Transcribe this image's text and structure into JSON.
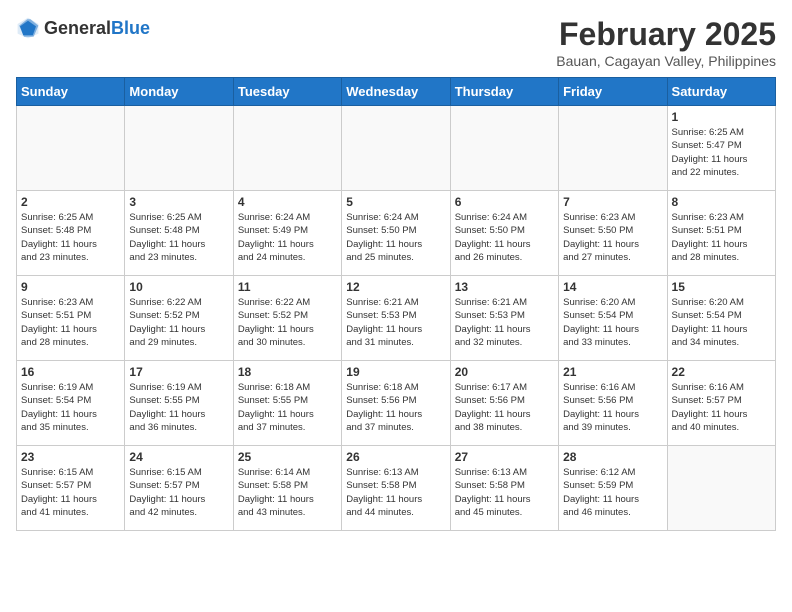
{
  "header": {
    "logo_general": "General",
    "logo_blue": "Blue",
    "month_title": "February 2025",
    "location": "Bauan, Cagayan Valley, Philippines"
  },
  "weekdays": [
    "Sunday",
    "Monday",
    "Tuesday",
    "Wednesday",
    "Thursday",
    "Friday",
    "Saturday"
  ],
  "weeks": [
    [
      {
        "day": "",
        "info": ""
      },
      {
        "day": "",
        "info": ""
      },
      {
        "day": "",
        "info": ""
      },
      {
        "day": "",
        "info": ""
      },
      {
        "day": "",
        "info": ""
      },
      {
        "day": "",
        "info": ""
      },
      {
        "day": "1",
        "info": "Sunrise: 6:25 AM\nSunset: 5:47 PM\nDaylight: 11 hours\nand 22 minutes."
      }
    ],
    [
      {
        "day": "2",
        "info": "Sunrise: 6:25 AM\nSunset: 5:48 PM\nDaylight: 11 hours\nand 23 minutes."
      },
      {
        "day": "3",
        "info": "Sunrise: 6:25 AM\nSunset: 5:48 PM\nDaylight: 11 hours\nand 23 minutes."
      },
      {
        "day": "4",
        "info": "Sunrise: 6:24 AM\nSunset: 5:49 PM\nDaylight: 11 hours\nand 24 minutes."
      },
      {
        "day": "5",
        "info": "Sunrise: 6:24 AM\nSunset: 5:50 PM\nDaylight: 11 hours\nand 25 minutes."
      },
      {
        "day": "6",
        "info": "Sunrise: 6:24 AM\nSunset: 5:50 PM\nDaylight: 11 hours\nand 26 minutes."
      },
      {
        "day": "7",
        "info": "Sunrise: 6:23 AM\nSunset: 5:50 PM\nDaylight: 11 hours\nand 27 minutes."
      },
      {
        "day": "8",
        "info": "Sunrise: 6:23 AM\nSunset: 5:51 PM\nDaylight: 11 hours\nand 28 minutes."
      }
    ],
    [
      {
        "day": "9",
        "info": "Sunrise: 6:23 AM\nSunset: 5:51 PM\nDaylight: 11 hours\nand 28 minutes."
      },
      {
        "day": "10",
        "info": "Sunrise: 6:22 AM\nSunset: 5:52 PM\nDaylight: 11 hours\nand 29 minutes."
      },
      {
        "day": "11",
        "info": "Sunrise: 6:22 AM\nSunset: 5:52 PM\nDaylight: 11 hours\nand 30 minutes."
      },
      {
        "day": "12",
        "info": "Sunrise: 6:21 AM\nSunset: 5:53 PM\nDaylight: 11 hours\nand 31 minutes."
      },
      {
        "day": "13",
        "info": "Sunrise: 6:21 AM\nSunset: 5:53 PM\nDaylight: 11 hours\nand 32 minutes."
      },
      {
        "day": "14",
        "info": "Sunrise: 6:20 AM\nSunset: 5:54 PM\nDaylight: 11 hours\nand 33 minutes."
      },
      {
        "day": "15",
        "info": "Sunrise: 6:20 AM\nSunset: 5:54 PM\nDaylight: 11 hours\nand 34 minutes."
      }
    ],
    [
      {
        "day": "16",
        "info": "Sunrise: 6:19 AM\nSunset: 5:54 PM\nDaylight: 11 hours\nand 35 minutes."
      },
      {
        "day": "17",
        "info": "Sunrise: 6:19 AM\nSunset: 5:55 PM\nDaylight: 11 hours\nand 36 minutes."
      },
      {
        "day": "18",
        "info": "Sunrise: 6:18 AM\nSunset: 5:55 PM\nDaylight: 11 hours\nand 37 minutes."
      },
      {
        "day": "19",
        "info": "Sunrise: 6:18 AM\nSunset: 5:56 PM\nDaylight: 11 hours\nand 37 minutes."
      },
      {
        "day": "20",
        "info": "Sunrise: 6:17 AM\nSunset: 5:56 PM\nDaylight: 11 hours\nand 38 minutes."
      },
      {
        "day": "21",
        "info": "Sunrise: 6:16 AM\nSunset: 5:56 PM\nDaylight: 11 hours\nand 39 minutes."
      },
      {
        "day": "22",
        "info": "Sunrise: 6:16 AM\nSunset: 5:57 PM\nDaylight: 11 hours\nand 40 minutes."
      }
    ],
    [
      {
        "day": "23",
        "info": "Sunrise: 6:15 AM\nSunset: 5:57 PM\nDaylight: 11 hours\nand 41 minutes."
      },
      {
        "day": "24",
        "info": "Sunrise: 6:15 AM\nSunset: 5:57 PM\nDaylight: 11 hours\nand 42 minutes."
      },
      {
        "day": "25",
        "info": "Sunrise: 6:14 AM\nSunset: 5:58 PM\nDaylight: 11 hours\nand 43 minutes."
      },
      {
        "day": "26",
        "info": "Sunrise: 6:13 AM\nSunset: 5:58 PM\nDaylight: 11 hours\nand 44 minutes."
      },
      {
        "day": "27",
        "info": "Sunrise: 6:13 AM\nSunset: 5:58 PM\nDaylight: 11 hours\nand 45 minutes."
      },
      {
        "day": "28",
        "info": "Sunrise: 6:12 AM\nSunset: 5:59 PM\nDaylight: 11 hours\nand 46 minutes."
      },
      {
        "day": "",
        "info": ""
      }
    ]
  ]
}
